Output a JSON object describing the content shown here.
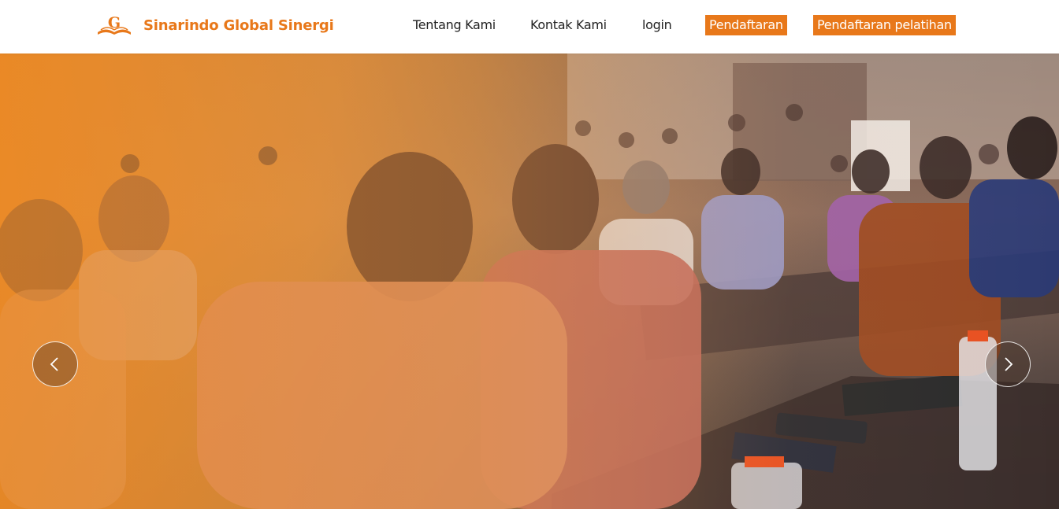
{
  "brand": {
    "name": "Sinarindo Global Sinergi",
    "logo_icon": "book-g-logo-icon",
    "accent_color": "#e8781a"
  },
  "nav": {
    "items": [
      {
        "label": "Tentang Kami"
      },
      {
        "label": "Kontak Kami"
      },
      {
        "label": "login"
      }
    ],
    "buttons": [
      {
        "label": "Pendaftaran"
      },
      {
        "label": "Pendaftaran pelatihan"
      }
    ]
  },
  "hero": {
    "prev_icon": "chevron-left-icon",
    "next_icon": "chevron-right-icon",
    "overlay_color": "#ec8c28"
  }
}
